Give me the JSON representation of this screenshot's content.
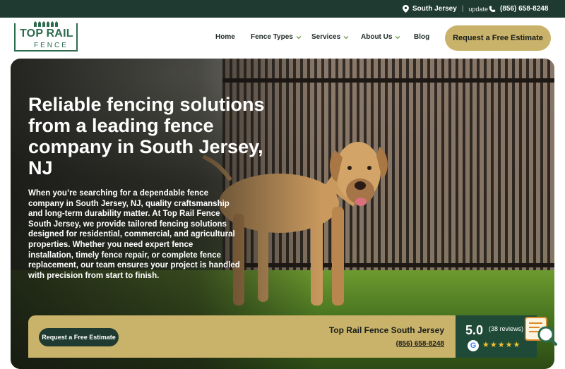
{
  "topbar": {
    "location": "South Jersey",
    "location_action": "update",
    "phone": "(856) 658-8248",
    "icons": {
      "location": "map-pin-icon",
      "phone": "phone-icon"
    }
  },
  "header": {
    "logo": {
      "line1": "TOP RAIL",
      "line2": "FENCE"
    },
    "nav": [
      {
        "label": "Home",
        "has_dropdown": false
      },
      {
        "label": "Fence Types",
        "has_dropdown": true
      },
      {
        "label": "Services",
        "has_dropdown": true
      },
      {
        "label": "About Us",
        "has_dropdown": true
      },
      {
        "label": "Blog",
        "has_dropdown": false
      }
    ],
    "cta": "Request a Free Estimate"
  },
  "hero": {
    "headline": "Reliable fencing solutions from a leading fence company in South Jersey, NJ",
    "body": "When you’re searching for a dependable fence company in South Jersey, NJ, quality craftsmanship and long-term durability matter. At Top Rail Fence South Jersey, we provide tailored fencing solutions designed for residential, commercial, and agricultural properties. Whether you need expert fence installation, timely fence repair, or complete fence replacement, our team ensures your project is handled with precision from start to finish."
  },
  "card": {
    "button": "Request a Free Estimate",
    "business": "Top Rail Fence South Jersey",
    "phone": "(856) 658-8248"
  },
  "rating": {
    "score": "5.0",
    "count": "(38 reviews)",
    "google": "G",
    "stars": "★★★★★"
  },
  "colors": {
    "dark_green": "#1f3a30",
    "brand_green": "#2e6b4e",
    "gold": "#c9b26a"
  }
}
